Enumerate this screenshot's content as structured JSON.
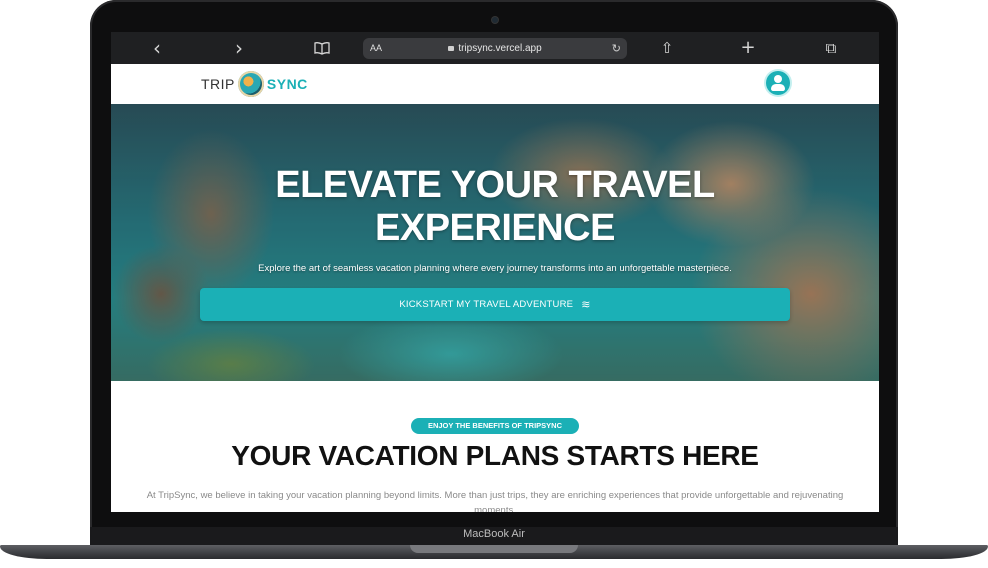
{
  "device": {
    "label": "MacBook Air"
  },
  "browser": {
    "back_icon": "‹",
    "forward_icon": "›",
    "reader_icon": "book-icon",
    "text_size": "AA",
    "url": "tripsync.vercel.app",
    "reload_icon": "↻",
    "share_icon": "⇧",
    "new_tab_icon": "+",
    "tabs_icon": "⧉"
  },
  "site": {
    "logo_left": "TRIP",
    "logo_right": "SYNC",
    "accent_color": "#1bb0b6"
  },
  "hero": {
    "title_line1": "ELEVATE YOUR TRAVEL",
    "title_line2": "EXPERIENCE",
    "subtitle": "Explore the art of seamless vacation planning where every journey transforms into an unforgettable masterpiece.",
    "cta_label": "KICKSTART MY TRAVEL ADVENTURE",
    "cta_icon": "≋"
  },
  "benefits": {
    "badge": "ENJOY THE BENEFITS OF TRIPSYNC",
    "title": "YOUR VACATION PLANS STARTS HERE",
    "body": "At TripSync, we believe in taking your vacation planning beyond limits. More than just trips, they are enriching experiences that provide unforgettable and rejuvenating moments."
  }
}
